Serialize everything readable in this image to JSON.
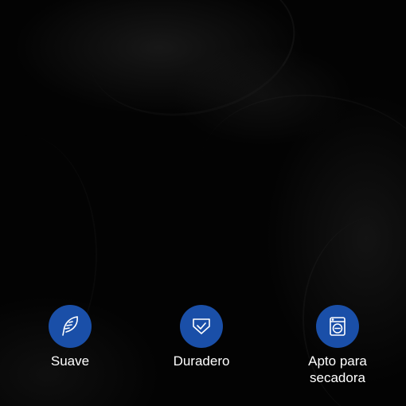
{
  "features": [
    {
      "label": "Suave",
      "icon": "feather-icon"
    },
    {
      "label": "Duradero",
      "icon": "shield-check-icon"
    },
    {
      "label_line1": "Apto para",
      "label_line2": "secadora",
      "icon": "dryer-icon"
    }
  ],
  "colors": {
    "background": "#000000",
    "badge": "#1a4fa8",
    "icon_stroke": "#ffffff",
    "label": "#ffffff"
  }
}
